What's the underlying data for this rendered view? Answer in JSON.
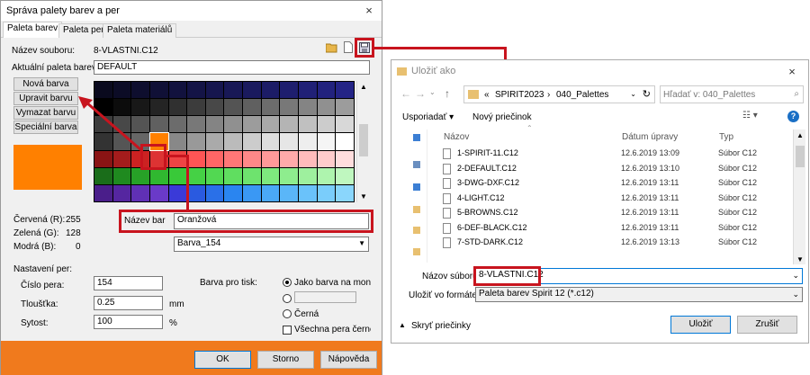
{
  "left_dialog": {
    "title": "Správa palety barev a per",
    "close": "×",
    "tabs": [
      "Paleta barev",
      "Paleta per",
      "Paleta materiálů"
    ],
    "file_label": "Název souboru:",
    "file_value": "8-VLASTNI.C12",
    "palette_label": "Aktuální paleta barev:",
    "palette_value": "DEFAULT",
    "buttons": [
      "Nová barva",
      "Upravit barvu",
      "Vymazat barvu",
      "Speciální barva"
    ],
    "rgb": {
      "r_label": "Červená (R):",
      "r": "255",
      "g_label": "Zelená (G):",
      "g": "128",
      "b_label": "Modrá (B):",
      "b": "0"
    },
    "name_label": "Název bar",
    "name_value": "Oranžová",
    "barva_select": "Barva_154",
    "pen_settings": "Nastavení per:",
    "pen_number_label": "Číslo pera:",
    "pen_number": "154",
    "thickness_label": "Tloušťka:",
    "thickness": "0.25",
    "thickness_unit": "mm",
    "saturation_label": "Sytost:",
    "saturation": "100",
    "saturation_unit": "%",
    "print_color_label": "Barva pro tisk:",
    "radio1": "Jako barva na monito",
    "radio3": "Černá",
    "all_pens_black": "Všechna pera černě",
    "ok": "OK",
    "cancel": "Storno",
    "help": "Nápověda",
    "accent_color": "#ff8000",
    "footer_color": "#f07a1d"
  },
  "right_dialog": {
    "title": "Uložiť ako",
    "close": "×",
    "breadcrumb": [
      "«",
      "SPIRIT2023",
      "›",
      "040_Palettes"
    ],
    "search_placeholder": "Hľadať v: 040_Palettes",
    "organize": "Usporiadať ▾",
    "new_folder": "Nový priečinok",
    "help_icon": "?",
    "columns": [
      "Názov",
      "Dátum úpravy",
      "Typ"
    ],
    "files": [
      {
        "name": "1-SPIRIT-11.C12",
        "date": "12.6.2019 13:09",
        "type": "Súbor C12"
      },
      {
        "name": "2-DEFAULT.C12",
        "date": "12.6.2019 13:10",
        "type": "Súbor C12"
      },
      {
        "name": "3-DWG-DXF.C12",
        "date": "12.6.2019 13:11",
        "type": "Súbor C12"
      },
      {
        "name": "4-LIGHT.C12",
        "date": "12.6.2019 13:11",
        "type": "Súbor C12"
      },
      {
        "name": "5-BROWNS.C12",
        "date": "12.6.2019 13:11",
        "type": "Súbor C12"
      },
      {
        "name": "6-DEF-BLACK.C12",
        "date": "12.6.2019 13:11",
        "type": "Súbor C12"
      },
      {
        "name": "7-STD-DARK.C12",
        "date": "12.6.2019 13:13",
        "type": "Súbor C12"
      }
    ],
    "filename_label": "Názov súboru:",
    "filename_value": "8-VLASTNI.C12",
    "format_label": "Uložiť vo formáte:",
    "format_value": "Paleta barev Spirit 12 (*.c12)",
    "hide_folders": "Skryť priečinky",
    "save": "Uložiť",
    "cancel": "Zrušiť"
  }
}
